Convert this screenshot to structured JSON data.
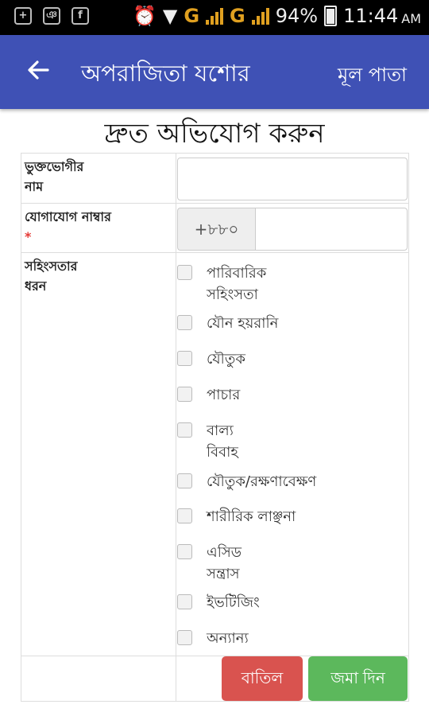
{
  "status_bar": {
    "signal_label_1": "G",
    "signal_label_2": "G",
    "battery": "94%",
    "time": "11:44",
    "ampm": "AM"
  },
  "app_bar": {
    "title": "অপরাজিতা যশোর",
    "home_link": "মূল পাতা"
  },
  "form": {
    "title": "দ্রুত অভিযোগ করুন",
    "victim_name_label_line1": "ভুক্তভোগীর",
    "victim_name_label_line2": "নাম",
    "victim_name_value": "",
    "contact_label": "যোগাযোগ নাম্বার",
    "required_mark": "*",
    "country_code": "+৮৮০",
    "phone_value": "",
    "violence_label_line1": "সহিংসতার",
    "violence_label_line2": "ধরন",
    "violence_types": [
      {
        "line1": "পারিবারিক",
        "line2": "সহিংসতা"
      },
      {
        "line1": "যৌন হয়রানি",
        "line2": ""
      },
      {
        "line1": "যৌতুক",
        "line2": ""
      },
      {
        "line1": "পাচার",
        "line2": ""
      },
      {
        "line1": "বাল্য",
        "line2": "বিবাহ"
      },
      {
        "line1": "যৌতুক/রক্ষণাবেক্ষণ",
        "line2": ""
      },
      {
        "line1": "শারীরিক লাঞ্ছনা",
        "line2": ""
      },
      {
        "line1": "এসিড",
        "line2": "সন্ত্রাস"
      },
      {
        "line1": "ইভটিজিং",
        "line2": ""
      },
      {
        "line1": "অন্যান্য",
        "line2": ""
      }
    ],
    "cancel_label": "বাতিল",
    "submit_label": "জমা দিন"
  },
  "colors": {
    "app_bar": "#3f51b5",
    "cancel": "#d9534f",
    "submit": "#5cb85c",
    "required": "#e53935"
  }
}
